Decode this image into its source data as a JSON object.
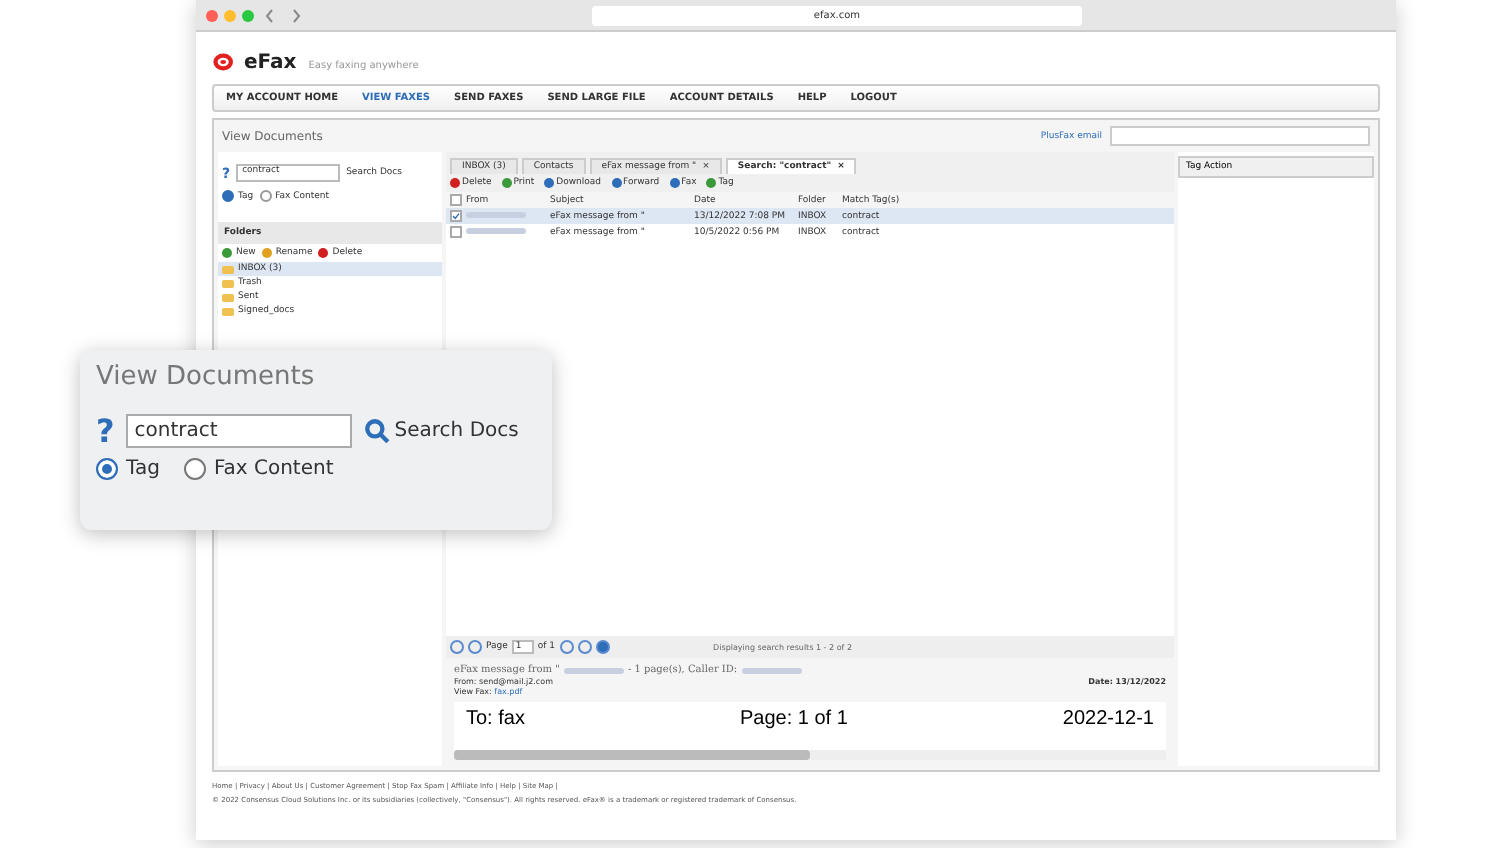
{
  "browser": {
    "url": "efax.com"
  },
  "logo": {
    "name": "eFax",
    "tagline": "Easy faxing anywhere"
  },
  "nav": [
    {
      "label": "MY ACCOUNT HOME",
      "selected": false
    },
    {
      "label": "VIEW FAXES",
      "selected": true
    },
    {
      "label": "SEND FAXES",
      "selected": false
    },
    {
      "label": "SEND LARGE FILE",
      "selected": false
    },
    {
      "label": "ACCOUNT DETAILS",
      "selected": false
    },
    {
      "label": "HELP",
      "selected": false
    },
    {
      "label": "LOGOUT",
      "selected": false
    }
  ],
  "left": {
    "help": "?",
    "title": "View Documents",
    "search_value": "contract",
    "search_button": "Search Docs",
    "radios": [
      {
        "label": "Tag",
        "selected": true
      },
      {
        "label": "Fax Content",
        "selected": false
      }
    ],
    "folders_title": "Folders",
    "folder_actions": [
      {
        "label": "New",
        "color": "#3a9a3a"
      },
      {
        "label": "Rename",
        "color": "#e0a020"
      },
      {
        "label": "Delete",
        "color": "#d02020"
      }
    ],
    "folders": [
      {
        "label": "INBOX (3)",
        "selected": true
      },
      {
        "label": "Trash",
        "selected": false
      },
      {
        "label": "Sent",
        "selected": false
      },
      {
        "label": "Signed_docs",
        "selected": false
      }
    ]
  },
  "plusfax_link": "PlusFax email",
  "tabs": [
    {
      "label": "INBOX (3)",
      "selected": false
    },
    {
      "label": "Contacts",
      "selected": false
    },
    {
      "label": "eFax message from \"",
      "selected": false,
      "close": "×"
    },
    {
      "label": "Search: \"contract\"",
      "selected": true,
      "close": "×"
    }
  ],
  "toolbar": [
    {
      "label": "Delete",
      "color": "#d02020"
    },
    {
      "label": "Print",
      "color": "#3a9a3a"
    },
    {
      "label": "Download",
      "color": "#2e6db8"
    },
    {
      "label": "Forward",
      "color": "#2e6db8"
    },
    {
      "label": "Fax",
      "color": "#2e6db8"
    },
    {
      "label": "Tag",
      "color": "#3a9a3a"
    }
  ],
  "table": {
    "all_checked": false,
    "columns": [
      "From",
      "Subject",
      "Date",
      "Folder",
      "Match Tag(s)"
    ],
    "rows": [
      {
        "checked": true,
        "selected": true,
        "subject": "eFax message from \"",
        "date": "13/12/2022 7:08 PM",
        "folder": "INBOX",
        "tags": "contract"
      },
      {
        "checked": false,
        "selected": false,
        "subject": "eFax message from \"",
        "date": "10/5/2022 0:56 PM",
        "folder": "INBOX",
        "tags": "contract"
      }
    ]
  },
  "pager": {
    "page_label": "Page",
    "page": "1",
    "of": "of 1",
    "summary": "Displaying search results 1 - 2 of 2"
  },
  "preview": {
    "title": "eFax message from \"",
    "title_rest": "- 1 page(s), Caller ID:",
    "from": "From: send@mail.j2.com",
    "date": "Date: 13/12/2022",
    "view_label": "View Fax:",
    "view_link": "fax.pdf"
  },
  "document": {
    "to": "To: fax",
    "page": "Page: 1 of 1",
    "date": "2022-12-1"
  },
  "tag_action": "Tag Action",
  "footer": {
    "links": "Home | Privacy | About Us | Customer Agreement | Stop Fax Spam | Affiliate Info | Help | Site Map |",
    "copyright": "© 2022 Consensus Cloud Solutions Inc. or its subsidiaries (collectively, \"Consensus\"). All rights reserved. eFax® is a trademark or registered trademark of Consensus."
  },
  "callout": {
    "help": "?",
    "title": "View Documents",
    "search_value": "contract",
    "search_button": "Search Docs",
    "radios": [
      {
        "label": "Tag",
        "selected": true
      },
      {
        "label": "Fax Content",
        "selected": false
      }
    ]
  }
}
